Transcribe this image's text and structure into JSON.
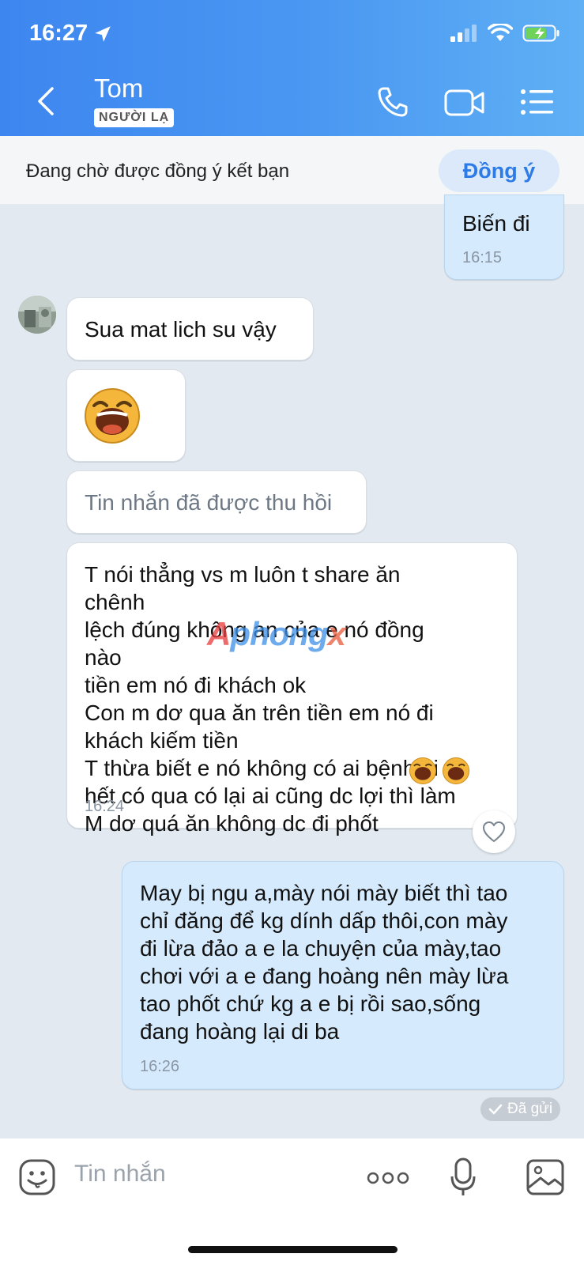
{
  "status_bar": {
    "time": "16:27"
  },
  "header": {
    "contact_name": "Tom",
    "stranger_badge": "NGƯỜI LẠ"
  },
  "friend_request": {
    "text": "Đang chờ được đồng ý kết bạn",
    "accept_label": "Đồng ý"
  },
  "messages": [
    {
      "direction": "out",
      "text": "Biến đi",
      "time": "16:15"
    },
    {
      "direction": "in",
      "text": "Sua mat lich su vậy"
    },
    {
      "direction": "in",
      "type": "sticker",
      "sticker": "laughing-face"
    },
    {
      "direction": "in",
      "type": "recalled",
      "text": "Tin nhắn đã được thu hồi"
    },
    {
      "direction": "in",
      "text": "T nói thẳng vs m luôn t share ăn chênh\nlệch đúng không an của e nó đồng nào\ntiền em nó đi khách ok\nCon m dơ qua ăn trên tiền em nó đi\nkhách kiếm tiền\nT thừa biết e nó không có ai bệnh gi\nhết có qua có lại ai cũng dc lợi thì làm\nM dơ quá ăn không dc đi phốt",
      "time": "16:24"
    },
    {
      "direction": "out",
      "text": "May bị ngu a,mày nói mày biết thì tao\nchỉ đăng để kg dính dấp thôi,con mày\nđi lừa đảo a e la chuyện của mày,tao\nchơi với a e đang hoàng nên mày lừa\ntao phốt chứ kg a e bị rồi sao,sống\nđang hoàng lại di ba",
      "time": "16:26"
    }
  ],
  "sent_status": "Đã gửi",
  "watermark": {
    "part1": "A",
    "part2": "phong",
    "part3": "x"
  },
  "composer": {
    "placeholder": "Tin nhắn"
  },
  "colors": {
    "header": "#3d86f0",
    "accent": "#2d7be6",
    "outgoing_bubble": "#d5eafc",
    "chat_bg": "#e2e9f1"
  }
}
